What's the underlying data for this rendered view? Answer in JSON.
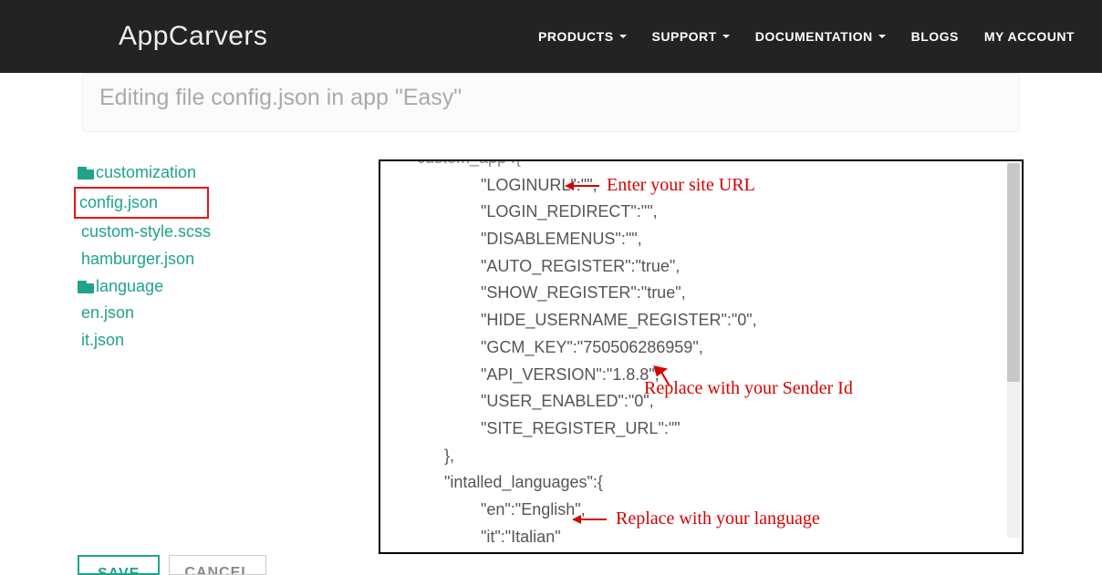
{
  "brand": "AppCarvers",
  "nav": {
    "products": "PRODUCTS",
    "support": "SUPPORT",
    "documentation": "DOCUMENTATION",
    "blogs": "BLOGS",
    "account": "MY ACCOUNT"
  },
  "subheader": "Editing file config.json in app \"Easy\"",
  "sidebar": {
    "folder_customization": "customization",
    "file_config": "config.json",
    "file_customstyle": "custom-style.scss",
    "file_hamburger": "hamburger.json",
    "folder_language": "language",
    "file_en": "en.json",
    "file_it": "it.json"
  },
  "editor_lines": {
    "l0": "custom_app :{",
    "l1": "\"LOGINURL\":\"\",",
    "l2": "\"LOGIN_REDIRECT\":\"\",",
    "l3": "\"DISABLEMENUS\":\"\",",
    "l4": "\"AUTO_REGISTER\":\"true\",",
    "l5": "\"SHOW_REGISTER\":\"true\",",
    "l6": "\"HIDE_USERNAME_REGISTER\":\"0\",",
    "l7": "\"GCM_KEY\":\"750506286959\",",
    "l8": "\"API_VERSION\":\"1.8.8\",",
    "l9": "\"USER_ENABLED\":\"0\",",
    "l10": "\"SITE_REGISTER_URL\":\"\"",
    "l11": "},",
    "l12": "\"intalled_languages\":{",
    "l13": "\"en\":\"English\",",
    "l14": "\"it\":\"Italian\""
  },
  "annotations": {
    "a1": "Enter your site URL",
    "a2": "Replace with your Sender Id",
    "a3": "Replace with your language"
  },
  "buttons": {
    "save": "SAVE",
    "cancel": "CANCEL"
  }
}
